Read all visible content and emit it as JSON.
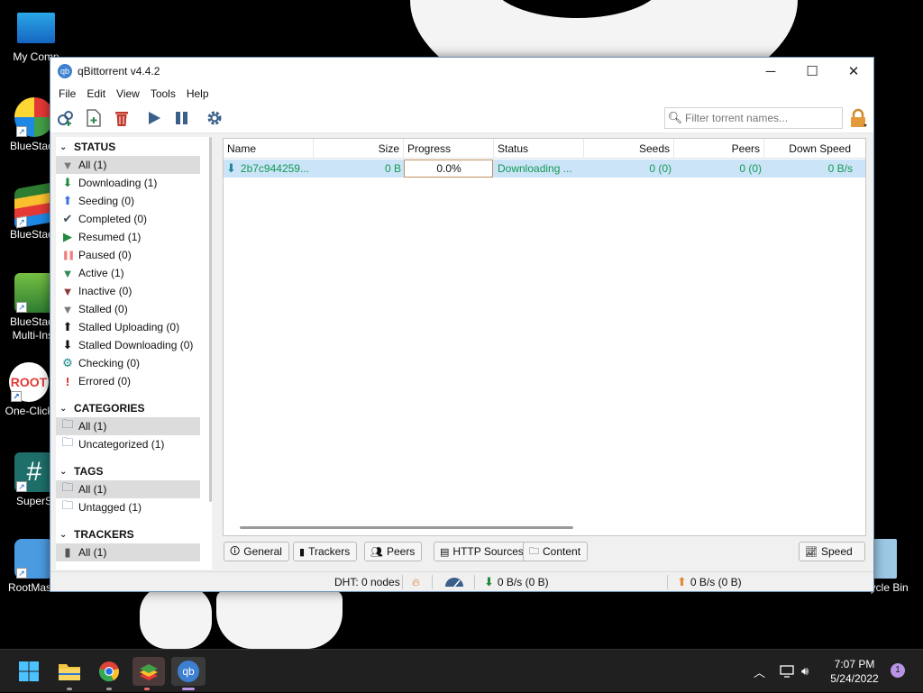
{
  "desktop": {
    "icons": [
      {
        "label": "My Comp",
        "icon": "monitor-icon"
      },
      {
        "label": "BlueStack",
        "icon": "bluestacks-icon"
      },
      {
        "label": "BlueStack",
        "icon": "bluestacks-x-icon"
      },
      {
        "label": "BlueStack Multi-Inst",
        "icon": "bluestacks-multi-icon"
      },
      {
        "label": "One-Click",
        "icon": "root-icon"
      },
      {
        "label": "SuperS",
        "icon": "hash-icon"
      },
      {
        "label": "RootMaste",
        "icon": "shield-icon"
      }
    ],
    "recycle_bin": {
      "label": "Recycle Bin",
      "icon": "recycle-bin-icon"
    }
  },
  "window": {
    "title": "qBittorrent v4.4.2",
    "app_icon_text": "qb",
    "controls": {
      "minimize": "─",
      "maximize": "☐",
      "close": "✕"
    },
    "menu": [
      "File",
      "Edit",
      "View",
      "Tools",
      "Help"
    ],
    "search": {
      "placeholder": "Filter torrent names..."
    }
  },
  "sidebar": {
    "status": {
      "heading": "STATUS",
      "items": [
        {
          "label": "All (1)",
          "icon": "filter-all-icon",
          "glyph": "▼",
          "color": "#7a7a7a"
        },
        {
          "label": "Downloading (1)",
          "icon": "download-arrow-icon",
          "glyph": "⬇",
          "color": "#1f8a3b"
        },
        {
          "label": "Seeding (0)",
          "icon": "upload-arrow-icon",
          "glyph": "⬆",
          "color": "#3b6fd8"
        },
        {
          "label": "Completed (0)",
          "icon": "check-icon",
          "glyph": "✔",
          "color": "#3d4b5c"
        },
        {
          "label": "Resumed (1)",
          "icon": "play-icon",
          "glyph": "▶",
          "color": "#1f8a3b"
        },
        {
          "label": "Paused (0)",
          "icon": "pause-icon",
          "glyph": "❚❚",
          "color": "#f08080"
        },
        {
          "label": "Active (1)",
          "icon": "filter-active-icon",
          "glyph": "▼",
          "color": "#2e8b57"
        },
        {
          "label": "Inactive (0)",
          "icon": "filter-inactive-icon",
          "glyph": "▼",
          "color": "#8b3a3a"
        },
        {
          "label": "Stalled (0)",
          "icon": "filter-stalled-icon",
          "glyph": "▼",
          "color": "#7a7a7a"
        },
        {
          "label": "Stalled Uploading (0)",
          "icon": "stalled-up-icon",
          "glyph": "⬆",
          "color": "#111111"
        },
        {
          "label": "Stalled Downloading (0)",
          "icon": "stalled-down-icon",
          "glyph": "⬇",
          "color": "#111111"
        },
        {
          "label": "Checking (0)",
          "icon": "gear-icon",
          "glyph": "⚙",
          "color": "#138a85"
        },
        {
          "label": "Errored (0)",
          "icon": "error-icon",
          "glyph": "!",
          "color": "#d91e1e"
        }
      ]
    },
    "categories": {
      "heading": "CATEGORIES",
      "items": [
        {
          "label": "All (1)",
          "icon": "folder-icon"
        },
        {
          "label": "Uncategorized (1)",
          "icon": "folder-icon"
        }
      ]
    },
    "tags": {
      "heading": "TAGS",
      "items": [
        {
          "label": "All (1)",
          "icon": "folder-icon"
        },
        {
          "label": "Untagged (1)",
          "icon": "folder-icon"
        }
      ]
    },
    "trackers": {
      "heading": "TRACKERS",
      "items": [
        {
          "label": "All (1)",
          "icon": "server-icon"
        }
      ]
    }
  },
  "table": {
    "columns": [
      "Name",
      "Size",
      "Progress",
      "Status",
      "Seeds",
      "Peers",
      "Down Speed"
    ],
    "rows": [
      {
        "name": "2b7c944259...",
        "size": "0 B",
        "progress": "0.0%",
        "progress_value": 0.0,
        "status": "Downloading ...",
        "seeds": "0 (0)",
        "peers": "0 (0)",
        "down_speed": "0 B/s"
      }
    ]
  },
  "bottom_tabs": [
    "General",
    "Trackers",
    "Peers",
    "HTTP Sources",
    "Content"
  ],
  "speed_button": "Speed",
  "statusbar": {
    "dht": "DHT: 0 nodes",
    "download": "0 B/s (0 B)",
    "upload": "0 B/s (0 B)"
  },
  "taskbar": {
    "time": "7:07 PM",
    "date": "5/24/2022",
    "notification_count": "1"
  },
  "colors": {
    "row_selected": "#cce4f7",
    "row_text": "#119a55",
    "toolbar_blue": "#3a5f8a"
  }
}
